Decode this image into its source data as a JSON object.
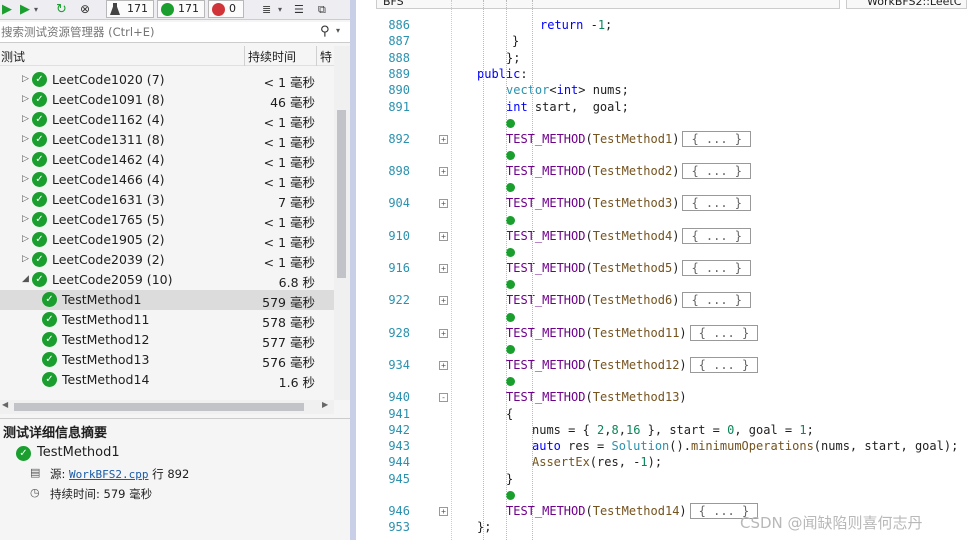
{
  "toolbar": {
    "total_count": "171",
    "passed_count": "171",
    "failed_count": "0"
  },
  "search": {
    "placeholder": "搜索测试资源管理器 (Ctrl+E)"
  },
  "columns": {
    "test": "测试",
    "duration": "持续时间",
    "extra": "特"
  },
  "tree": [
    {
      "name": "LeetCode1020 (7)",
      "duration": "< 1 毫秒",
      "level": 1
    },
    {
      "name": "LeetCode1091 (8)",
      "duration": "46 毫秒",
      "level": 1
    },
    {
      "name": "LeetCode1162 (4)",
      "duration": "< 1 毫秒",
      "level": 1
    },
    {
      "name": "LeetCode1311 (8)",
      "duration": "< 1 毫秒",
      "level": 1
    },
    {
      "name": "LeetCode1462 (4)",
      "duration": "< 1 毫秒",
      "level": 1
    },
    {
      "name": "LeetCode1466 (4)",
      "duration": "< 1 毫秒",
      "level": 1
    },
    {
      "name": "LeetCode1631 (3)",
      "duration": "7 毫秒",
      "level": 1
    },
    {
      "name": "LeetCode1765 (5)",
      "duration": "< 1 毫秒",
      "level": 1
    },
    {
      "name": "LeetCode1905 (2)",
      "duration": "< 1 毫秒",
      "level": 1
    },
    {
      "name": "LeetCode2039 (2)",
      "duration": "< 1 毫秒",
      "level": 1
    },
    {
      "name": "LeetCode2059 (10)",
      "duration": "6.8 秒",
      "level": 1,
      "expanded": true
    },
    {
      "name": "TestMethod1",
      "duration": "579 毫秒",
      "level": 2,
      "selected": true
    },
    {
      "name": "TestMethod11",
      "duration": "578 毫秒",
      "level": 2
    },
    {
      "name": "TestMethod12",
      "duration": "577 毫秒",
      "level": 2
    },
    {
      "name": "TestMethod13",
      "duration": "576 毫秒",
      "level": 2
    },
    {
      "name": "TestMethod14",
      "duration": "1.6 秒",
      "level": 2
    }
  ],
  "details": {
    "title": "测试详细信息摘要",
    "test_name": "TestMethod1",
    "source_label": "源:",
    "source_file": "WorkBFS2.cpp",
    "line_label": "行 892",
    "duration_label": "持续时间:",
    "duration_value": "579 毫秒"
  },
  "editor": {
    "file_dropdown": "BFS",
    "scope_dropdown": "WorkBFS2::LeetC",
    "lines": [
      {
        "n": "886",
        "html": "<span class='kw'>return</span> -<span class='num'>1</span>;",
        "indent": 184
      },
      {
        "n": "887",
        "html": "}",
        "indent": 156
      },
      {
        "n": "888",
        "html": "};",
        "indent": 150
      },
      {
        "n": "889",
        "html": "<span class='kw'>public</span>:",
        "indent": 121
      },
      {
        "n": "890",
        "html": "<span class='ty'>vector</span>&lt;<span class='kw'>int</span>&gt; nums;",
        "indent": 150
      },
      {
        "n": "891",
        "html": "<span class='kw'>int</span> start,  goal;",
        "indent": 150
      },
      {
        "n": "892",
        "html": "<span class='cm'>TEST_METHOD</span>(<span class='fn'>TestMethod1</span>)<span class='collapsed'>{ ... }</span>",
        "indent": 150,
        "fold": "+",
        "tick": true
      },
      {
        "n": "898",
        "html": "<span class='cm'>TEST_METHOD</span>(<span class='fn'>TestMethod2</span>)<span class='collapsed'>{ ... }</span>",
        "indent": 150,
        "fold": "+",
        "tick": true
      },
      {
        "n": "904",
        "html": "<span class='cm'>TEST_METHOD</span>(<span class='fn'>TestMethod3</span>)<span class='collapsed'>{ ... }</span>",
        "indent": 150,
        "fold": "+",
        "tick": true
      },
      {
        "n": "910",
        "html": "<span class='cm'>TEST_METHOD</span>(<span class='fn'>TestMethod4</span>)<span class='collapsed'>{ ... }</span>",
        "indent": 150,
        "fold": "+",
        "tick": true
      },
      {
        "n": "916",
        "html": "<span class='cm'>TEST_METHOD</span>(<span class='fn'>TestMethod5</span>)<span class='collapsed'>{ ... }</span>",
        "indent": 150,
        "fold": "+",
        "tick": true
      },
      {
        "n": "922",
        "html": "<span class='cm'>TEST_METHOD</span>(<span class='fn'>TestMethod6</span>)<span class='collapsed'>{ ... }</span>",
        "indent": 150,
        "fold": "+",
        "tick": true
      },
      {
        "n": "928",
        "html": "<span class='cm'>TEST_METHOD</span>(<span class='fn'>TestMethod11</span>)<span class='collapsed'>{ ... }</span>",
        "indent": 150,
        "fold": "+",
        "tick": true
      },
      {
        "n": "934",
        "html": "<span class='cm'>TEST_METHOD</span>(<span class='fn'>TestMethod12</span>)<span class='collapsed'>{ ... }</span>",
        "indent": 150,
        "fold": "+",
        "tick": true
      },
      {
        "n": "940",
        "html": "<span class='cm'>TEST_METHOD</span>(<span class='fn'>TestMethod13</span>)",
        "indent": 150,
        "fold": "-",
        "tick": true
      },
      {
        "n": "941",
        "html": "{",
        "indent": 150
      },
      {
        "n": "942",
        "html": "nums = { <span class='num'>2</span>,<span class='num'>8</span>,<span class='num'>16</span> }, start = <span class='num'>0</span>, goal = <span class='num'>1</span>;",
        "indent": 176
      },
      {
        "n": "943",
        "html": "<span class='kw'>auto</span> res = <span class='ty'>Solution</span>().<span class='fn'>minimumOperations</span>(nums, start, goal);",
        "indent": 176
      },
      {
        "n": "944",
        "html": "<span class='fn'>AssertEx</span>(res, -<span class='num'>1</span>);",
        "indent": 176
      },
      {
        "n": "945",
        "html": "}",
        "indent": 150
      },
      {
        "n": "946",
        "html": "<span class='cm'>TEST_METHOD</span>(<span class='fn'>TestMethod14</span>)<span class='collapsed'>{ ... }</span>",
        "indent": 150,
        "fold": "+",
        "tick": true
      },
      {
        "n": "953",
        "html": "};",
        "indent": 121
      }
    ]
  },
  "watermark": "CSDN @闻缺陷则喜何志丹"
}
